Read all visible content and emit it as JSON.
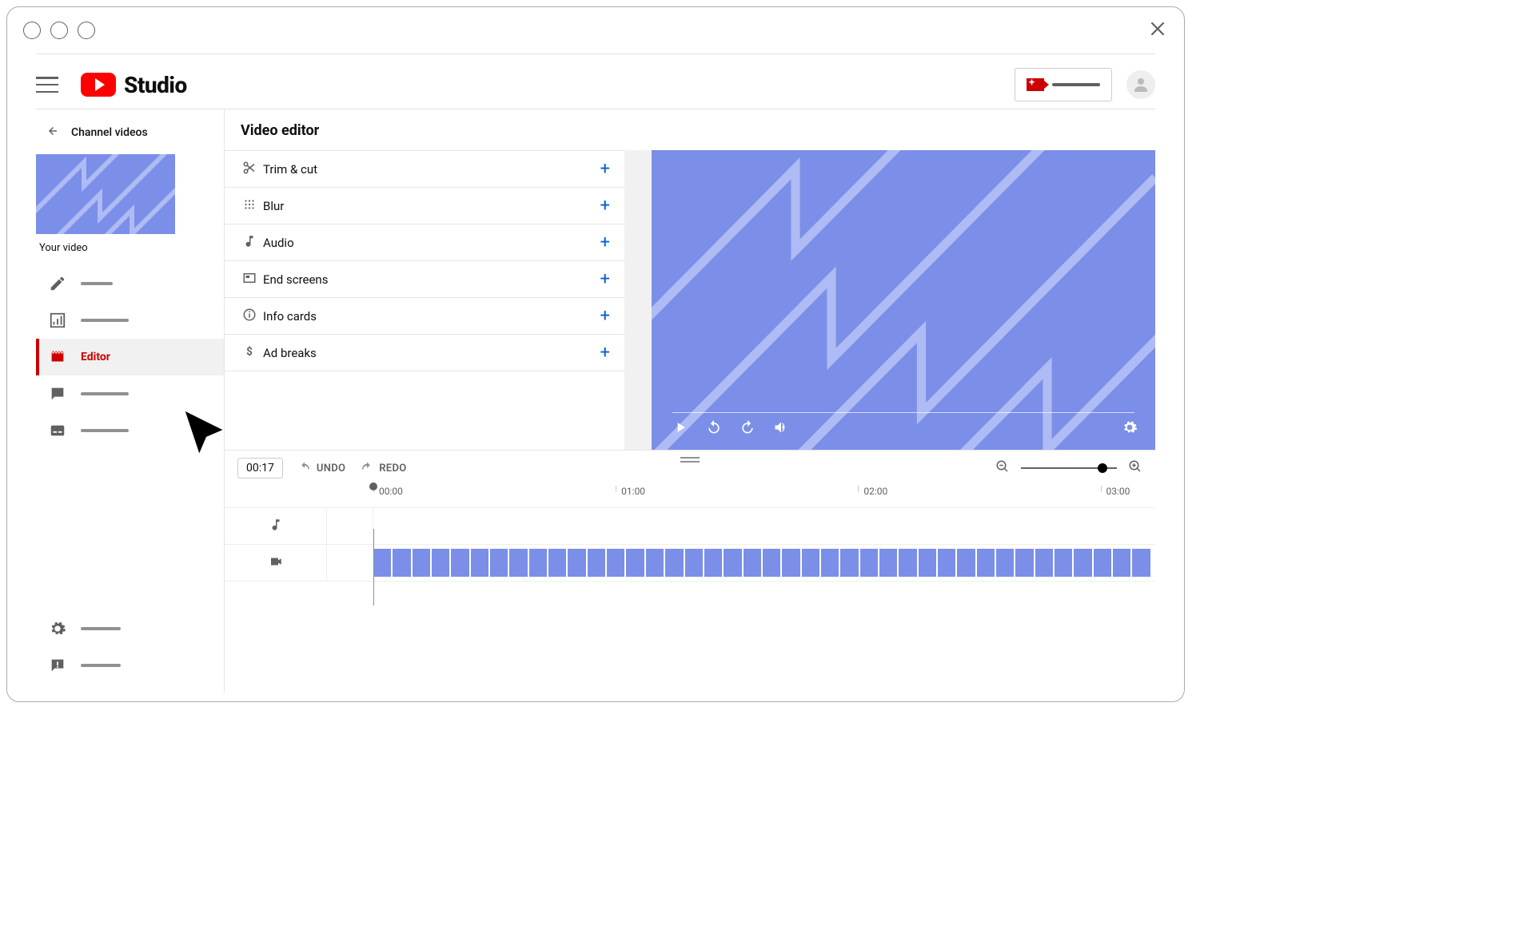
{
  "brand": {
    "name": "Studio"
  },
  "header": {
    "create_label": ""
  },
  "sidebar": {
    "back_label": "Channel videos",
    "your_video_label": "Your video",
    "items": [
      {
        "id": "details",
        "label": ""
      },
      {
        "id": "analytics",
        "label": ""
      },
      {
        "id": "editor",
        "label": "Editor"
      },
      {
        "id": "comments",
        "label": ""
      },
      {
        "id": "subtitles",
        "label": ""
      }
    ],
    "bottom": [
      {
        "id": "settings",
        "label": ""
      },
      {
        "id": "feedback",
        "label": ""
      }
    ]
  },
  "page": {
    "title": "Video editor"
  },
  "tools": [
    {
      "id": "trim",
      "label": "Trim & cut"
    },
    {
      "id": "blur",
      "label": "Blur"
    },
    {
      "id": "audio",
      "label": "Audio"
    },
    {
      "id": "endscreens",
      "label": "End screens"
    },
    {
      "id": "infocards",
      "label": "Info cards"
    },
    {
      "id": "adbreaks",
      "label": "Ad breaks"
    }
  ],
  "timeline": {
    "timecode": "00:17",
    "undo_label": "UNDO",
    "redo_label": "REDO",
    "ticks": [
      "00:00",
      "01:00",
      "02:00",
      "03:00"
    ]
  }
}
